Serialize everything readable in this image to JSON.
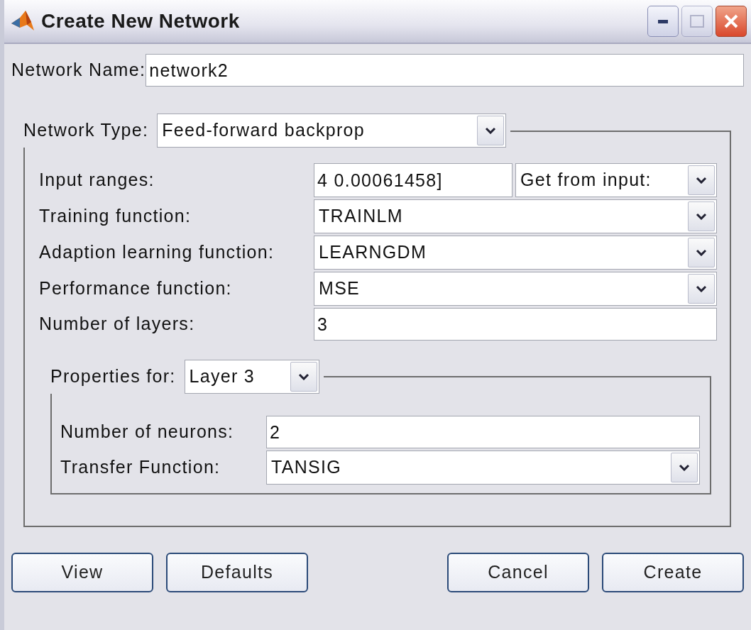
{
  "window": {
    "title": "Create New Network"
  },
  "name_field": {
    "label": "Network Name:",
    "value": "network2"
  },
  "network_type": {
    "label": "Network Type:",
    "value": "Feed-forward backprop"
  },
  "rows": [
    {
      "kind": "field_combo",
      "label": "Input ranges:",
      "value": "4 0.00061458]",
      "combo_value": "Get from input:"
    },
    {
      "kind": "combo",
      "label": "Training function:",
      "value": "TRAINLM"
    },
    {
      "kind": "combo",
      "label": "Adaption learning function:",
      "value": "LEARNGDM"
    },
    {
      "kind": "combo",
      "label": "Performance function:",
      "value": "MSE"
    },
    {
      "kind": "field",
      "label": "Number of layers:",
      "value": "3"
    }
  ],
  "layer_properties": {
    "label": "Properties for:",
    "value": "Layer 3",
    "rows": [
      {
        "kind": "field",
        "label": "Number of neurons:",
        "value": "2"
      },
      {
        "kind": "combo",
        "label": "Transfer Function:",
        "value": "TANSIG"
      }
    ]
  },
  "left_buttons": [
    "View",
    "Defaults"
  ],
  "right_buttons": [
    "Cancel",
    "Create"
  ]
}
